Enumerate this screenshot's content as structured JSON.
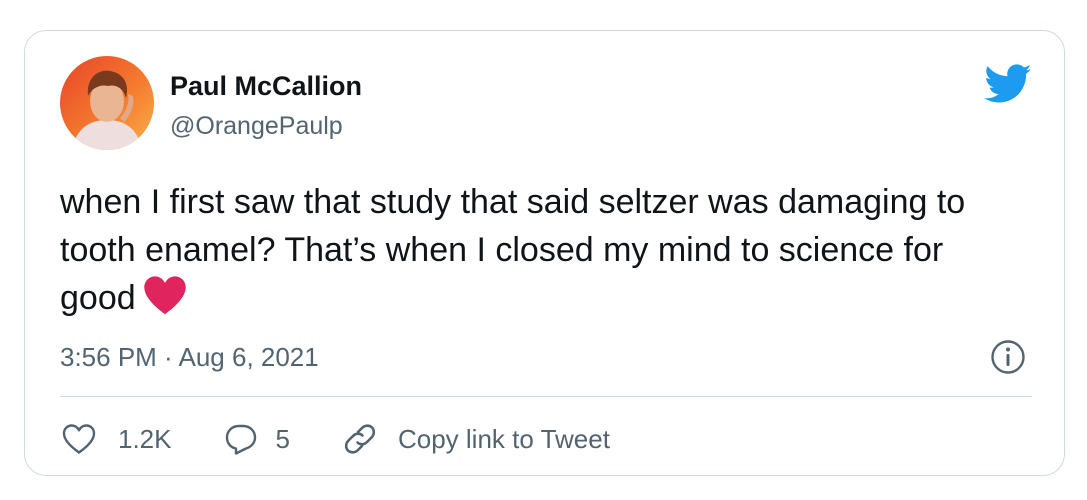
{
  "tweet": {
    "author": {
      "display_name": "Paul McCallion",
      "handle": "@OrangePaulp",
      "avatar_icon": "profile-avatar"
    },
    "text": "when I first saw that study that said seltzer was damaging to tooth enamel? That’s when I closed my mind to science for good",
    "emoji": "red-heart-emoji",
    "timestamp": "3:56 PM · Aug 6, 2021"
  },
  "actions": {
    "like_count": "1.2K",
    "reply_count": "5",
    "copy_link_label": "Copy link to Tweet"
  },
  "icons": {
    "brand": "twitter-bird-icon",
    "info": "info-icon",
    "like": "heart-outline-icon",
    "reply": "speech-bubble-icon",
    "link": "link-chain-icon"
  },
  "colors": {
    "twitter_blue": "#1d9bf0",
    "emoji_red": "#e0245e",
    "text_primary": "#0f1419",
    "text_secondary": "#536471",
    "border": "#cfd9de"
  }
}
